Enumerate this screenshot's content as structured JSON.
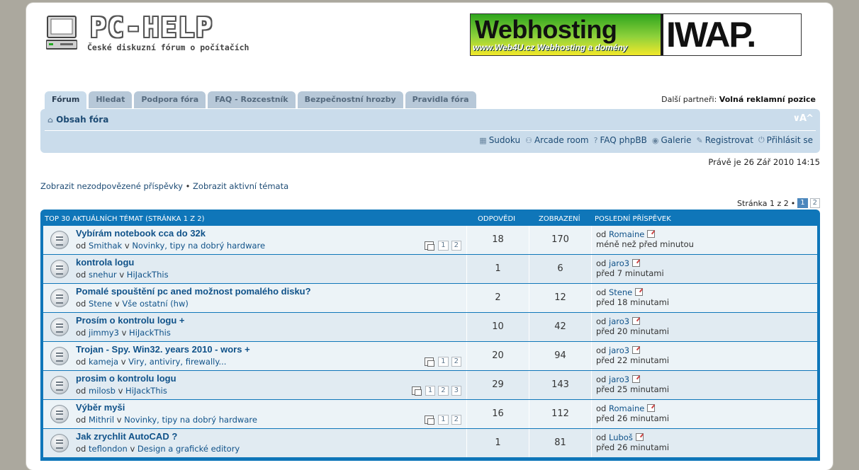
{
  "header": {
    "logo_title": "PC-HELP",
    "logo_subtitle": "České diskuzní fórum o počítačích",
    "banner_main": "Webhosting",
    "banner_sub": "www.Web4U.cz  Webhosting a domény",
    "banner_right": "IWAP."
  },
  "tabs": [
    {
      "label": "Fórum",
      "active": true
    },
    {
      "label": "Hledat"
    },
    {
      "label": "Podpora fóra"
    },
    {
      "label": "FAQ - Rozcestník"
    },
    {
      "label": "Bezpečnostní hrozby"
    },
    {
      "label": "Pravidla fóra"
    }
  ],
  "partners": {
    "label": "Další partneři:",
    "value": "Volná reklamní pozice"
  },
  "navbar": {
    "home": "Obsah fóra",
    "fontsize": "∨A^",
    "links": [
      "Sudoku",
      "Arcade room",
      "FAQ phpBB",
      "Galerie",
      "Registrovat",
      "Přihlásit se"
    ]
  },
  "time_info": "Právě je 26 Zář 2010 14:15",
  "quicklinks": {
    "unanswered": "Zobrazit nezodpovězené příspěvky",
    "sep": "•",
    "active": "Zobrazit aktivní témata"
  },
  "pager": {
    "label": "Stránka 1 z 2",
    "sep": "•",
    "pages": [
      "1",
      "2"
    ]
  },
  "table_header": {
    "topics": "TOP 30 AKTUÁLNÍCH TÉMAT (STRÁNKA 1 Z 2)",
    "replies": "ODPOVĚDI",
    "views": "ZOBRAZENÍ",
    "last_post": "POSLEDNÍ PŘÍSPĚVEK"
  },
  "topics": [
    {
      "title": "Vybírám notebook cca do 32k",
      "by": "od",
      "author": "Smithak",
      "in": "v",
      "forum": "Novinky, tipy na dobrý hardware",
      "pages": [
        "1",
        "2"
      ],
      "replies": "18",
      "views": "170",
      "last_by": "od",
      "last_author": "Romaine",
      "last_time": "méně než před minutou"
    },
    {
      "title": "kontrola logu",
      "by": "od",
      "author": "snehur",
      "in": "v",
      "forum": "HiJackThis",
      "pages": [],
      "replies": "1",
      "views": "6",
      "last_by": "od",
      "last_author": "jaro3",
      "last_time": "před 7 minutami"
    },
    {
      "title": "Pomalé spouštění pc aned možnost pomalého disku?",
      "by": "od",
      "author": "Stene",
      "in": "v",
      "forum": "Vše ostatní (hw)",
      "pages": [],
      "replies": "2",
      "views": "12",
      "last_by": "od",
      "last_author": "Stene",
      "last_time": "před 18 minutami"
    },
    {
      "title": "Prosím o kontrolu logu +",
      "by": "od",
      "author": "jimmy3",
      "in": "v",
      "forum": "HiJackThis",
      "pages": [],
      "replies": "10",
      "views": "42",
      "last_by": "od",
      "last_author": "jaro3",
      "last_time": "před 20 minutami"
    },
    {
      "title": "Trojan - Spy. Win32. years 2010 - wors +",
      "by": "od",
      "author": "kameja",
      "in": "v",
      "forum": "Viry, antiviry, firewally...",
      "pages": [
        "1",
        "2"
      ],
      "replies": "20",
      "views": "94",
      "last_by": "od",
      "last_author": "jaro3",
      "last_time": "před 22 minutami"
    },
    {
      "title": "prosim o kontrolu logu",
      "by": "od",
      "author": "milosb",
      "in": "v",
      "forum": "HiJackThis",
      "pages": [
        "1",
        "2",
        "3"
      ],
      "replies": "29",
      "views": "143",
      "last_by": "od",
      "last_author": "jaro3",
      "last_time": "před 25 minutami"
    },
    {
      "title": "Výběr myši",
      "by": "od",
      "author": "Mithril",
      "in": "v",
      "forum": "Novinky, tipy na dobrý hardware",
      "pages": [
        "1",
        "2"
      ],
      "replies": "16",
      "views": "112",
      "last_by": "od",
      "last_author": "Romaine",
      "last_time": "před 26 minutami"
    },
    {
      "title": "Jak zrychlit AutoCAD ?",
      "by": "od",
      "author": "teflondon",
      "in": "v",
      "forum": "Design a grafické editory",
      "pages": [],
      "replies": "1",
      "views": "81",
      "last_by": "od",
      "last_author": "Luboš",
      "last_time": "před 26 minutami"
    }
  ]
}
